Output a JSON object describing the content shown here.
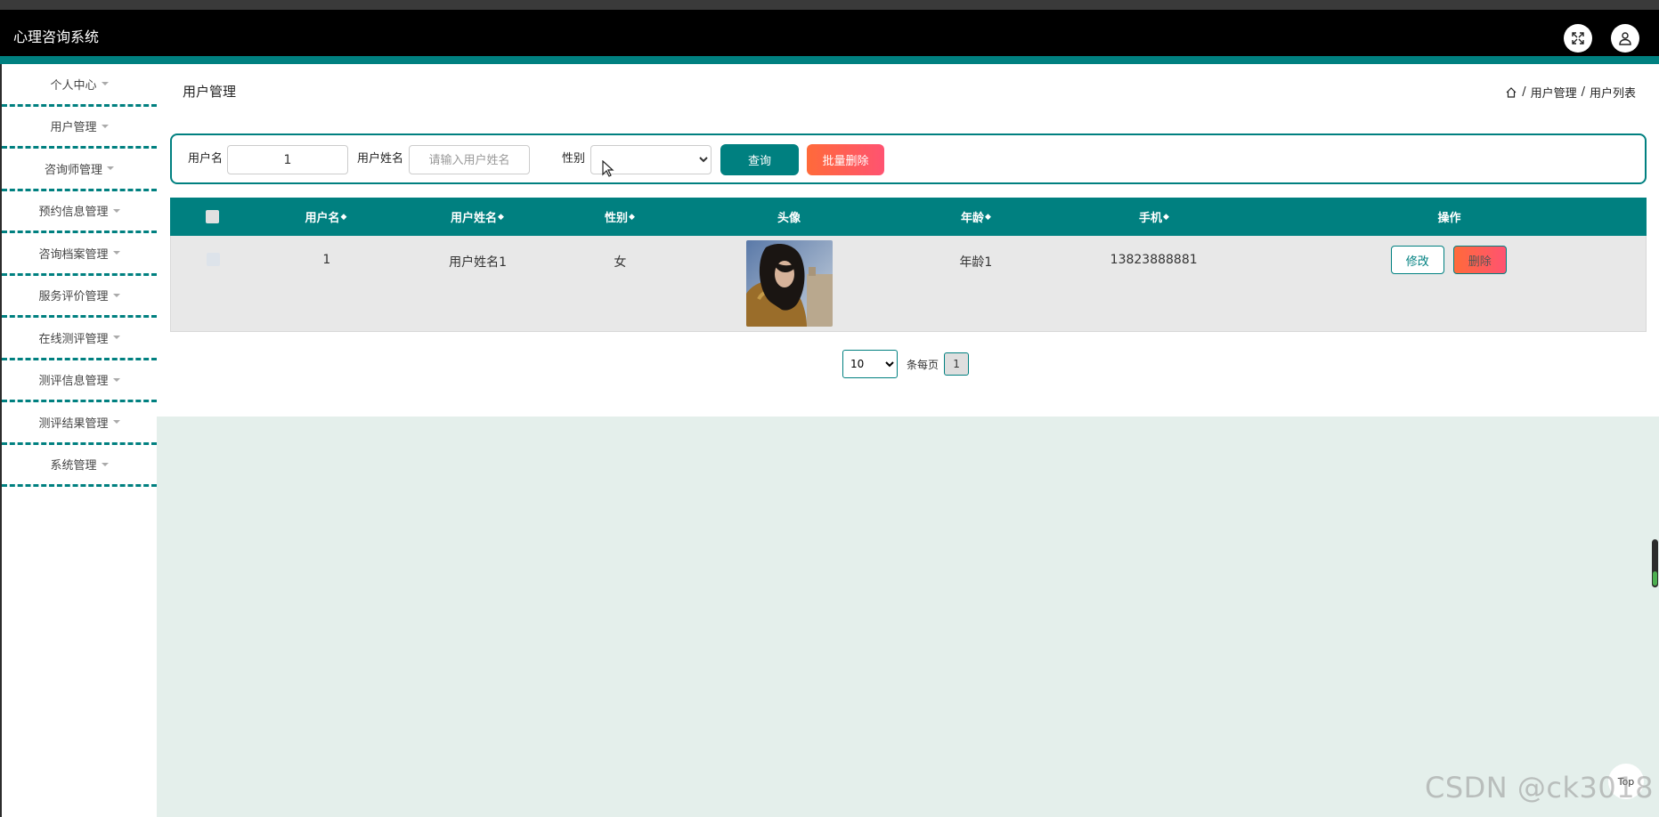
{
  "header": {
    "title": "心理咨询系统",
    "fullscreen_icon": "expand-icon",
    "user_icon": "user-icon"
  },
  "sidebar": {
    "items": [
      {
        "label": "个人中心"
      },
      {
        "label": "用户管理"
      },
      {
        "label": "咨询师管理"
      },
      {
        "label": "预约信息管理"
      },
      {
        "label": "咨询档案管理"
      },
      {
        "label": "服务评价管理"
      },
      {
        "label": "在线测评管理"
      },
      {
        "label": "测评信息管理"
      },
      {
        "label": "测评结果管理"
      },
      {
        "label": "系统管理"
      }
    ]
  },
  "page": {
    "title": "用户管理",
    "breadcrumb": {
      "home_icon": "home-icon",
      "separator": "/",
      "items": [
        "用户管理",
        "用户列表"
      ]
    }
  },
  "search": {
    "username_label": "用户名",
    "username_value": "1",
    "name_label": "用户姓名",
    "name_placeholder": "请输入用户姓名",
    "gender_label": "性别",
    "gender_value": "",
    "query_label": "查询",
    "batch_delete_label": "批量删除"
  },
  "table": {
    "headers": [
      "用户名",
      "用户姓名",
      "性别",
      "头像",
      "年龄",
      "手机",
      "操作"
    ],
    "rows": [
      {
        "username": "1",
        "name": "用户姓名1",
        "gender": "女",
        "avatar": "avatar-photo",
        "age": "年龄1",
        "phone": "13823888881",
        "edit_label": "修改",
        "delete_label": "删除"
      }
    ]
  },
  "pagination": {
    "page_size": "10",
    "per_page_label": "条每页",
    "current_page": "1"
  },
  "misc": {
    "top_label": "Top",
    "watermark": "CSDN @ck3018"
  },
  "colors": {
    "primary": "#008080",
    "danger_from": "#ff6a3a",
    "danger_to": "#ff5371",
    "content_bg": "#e4efeb"
  }
}
